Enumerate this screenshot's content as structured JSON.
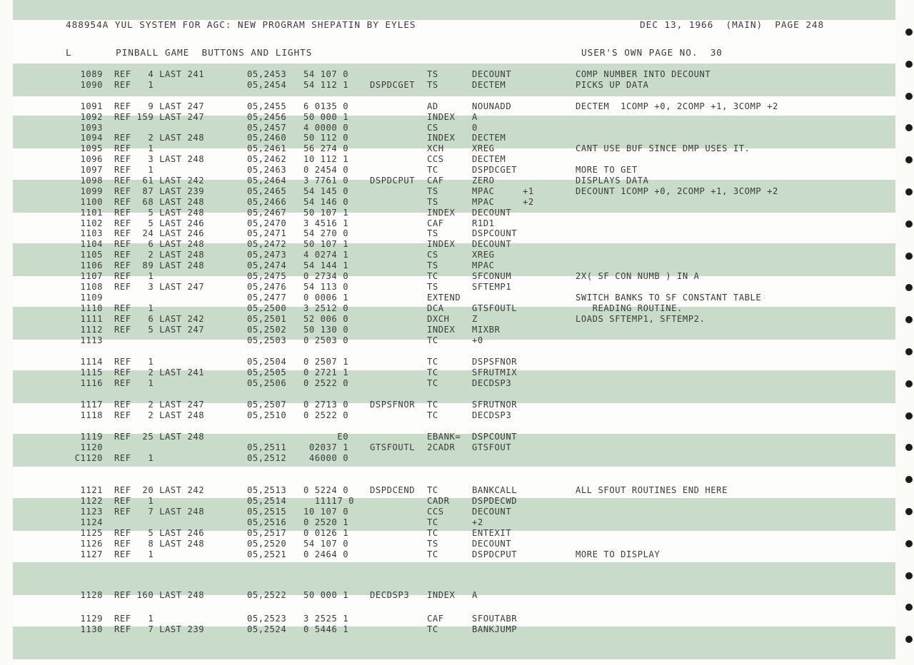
{
  "header": {
    "left": "488954A YUL SYSTEM FOR AGC: NEW PROGRAM SHEPATIN BY EYLES",
    "right": "DEC 13, 1966  (MAIN)  PAGE 248"
  },
  "section": {
    "marker": "L",
    "title": "PINBALL GAME  BUTTONS AND LIGHTS",
    "page_note": "USER'S OWN PAGE NO.  30"
  },
  "rows": [
    {
      "ln": "1089",
      "rf": "REF   4 LAST 241",
      "ad": "05,2453",
      "oc": "54 107 0",
      "lb": "",
      "op": "TS",
      "od": "DECOUNT",
      "cm": "COMP NUMBER INTO DECOUNT"
    },
    {
      "ln": "1090",
      "rf": "REF   1",
      "ad": "05,2454",
      "oc": "54 112 1",
      "lb": "DSPDCGET",
      "op": "TS",
      "od": "DECTEM",
      "cm": "PICKS UP DATA"
    },
    {
      "ln": "1091",
      "rf": "REF   9 LAST 247",
      "ad": "05,2455",
      "oc": "6 0135 0",
      "lb": "",
      "op": "AD",
      "od": "NOUNADD",
      "cm": "DECTEM  1COMP +0, 2COMP +1, 3COMP +2"
    },
    {
      "ln": "1092",
      "rf": "REF 159 LAST 247",
      "ad": "05,2456",
      "oc": "50 000 1",
      "lb": "",
      "op": "INDEX",
      "od": "A",
      "cm": ""
    },
    {
      "ln": "1093",
      "rf": "",
      "ad": "05,2457",
      "oc": "4 0000 0",
      "lb": "",
      "op": "CS",
      "od": "0",
      "cm": ""
    },
    {
      "ln": "1094",
      "rf": "REF   2 LAST 248",
      "ad": "05,2460",
      "oc": "50 112 0",
      "lb": "",
      "op": "INDEX",
      "od": "DECTEM",
      "cm": ""
    },
    {
      "ln": "1095",
      "rf": "REF   1",
      "ad": "05,2461",
      "oc": "56 274 0",
      "lb": "",
      "op": "XCH",
      "od": "XREG",
      "cm": "CANT USE BUF SINCE DMP USES IT."
    },
    {
      "ln": "1096",
      "rf": "REF   3 LAST 248",
      "ad": "05,2462",
      "oc": "10 112 1",
      "lb": "",
      "op": "CCS",
      "od": "DECTEM",
      "cm": ""
    },
    {
      "ln": "1097",
      "rf": "REF   1",
      "ad": "05,2463",
      "oc": "0 2454 0",
      "lb": "",
      "op": "TC",
      "od": "DSPDCGET",
      "cm": "MORE TO GET"
    },
    {
      "ln": "1098",
      "rf": "REF  61 LAST 242",
      "ad": "05,2464",
      "oc": "3 7761 0",
      "lb": "DSPDCPUT",
      "op": "CAF",
      "od": "ZERO",
      "cm": "DISPLAYS DATA"
    },
    {
      "ln": "1099",
      "rf": "REF  87 LAST 239",
      "ad": "05,2465",
      "oc": "54 145 0",
      "lb": "",
      "op": "TS",
      "od": "MPAC     +1",
      "cm": "DECOUNT 1COMP +0, 2COMP +1, 3COMP +2"
    },
    {
      "ln": "1100",
      "rf": "REF  68 LAST 248",
      "ad": "05,2466",
      "oc": "54 146 0",
      "lb": "",
      "op": "TS",
      "od": "MPAC     +2",
      "cm": ""
    },
    {
      "ln": "1101",
      "rf": "REF   5 LAST 248",
      "ad": "05,2467",
      "oc": "50 107 1",
      "lb": "",
      "op": "INDEX",
      "od": "DECOUNT",
      "cm": ""
    },
    {
      "ln": "1102",
      "rf": "REF   5 LAST 246",
      "ad": "05,2470",
      "oc": "3 4516 1",
      "lb": "",
      "op": "CAF",
      "od": "R1D1",
      "cm": ""
    },
    {
      "ln": "1103",
      "rf": "REF  24 LAST 246",
      "ad": "05,2471",
      "oc": "54 270 0",
      "lb": "",
      "op": "TS",
      "od": "DSPCOUNT",
      "cm": ""
    },
    {
      "ln": "1104",
      "rf": "REF   6 LAST 248",
      "ad": "05,2472",
      "oc": "50 107 1",
      "lb": "",
      "op": "INDEX",
      "od": "DECOUNT",
      "cm": ""
    },
    {
      "ln": "1105",
      "rf": "REF   2 LAST 248",
      "ad": "05,2473",
      "oc": "4 0274 1",
      "lb": "",
      "op": "CS",
      "od": "XREG",
      "cm": ""
    },
    {
      "ln": "1106",
      "rf": "REF  89 LAST 248",
      "ad": "05,2474",
      "oc": "54 144 1",
      "lb": "",
      "op": "TS",
      "od": "MPAC",
      "cm": ""
    },
    {
      "ln": "1107",
      "rf": "REF   1",
      "ad": "05,2475",
      "oc": "0 2734 0",
      "lb": "",
      "op": "TC",
      "od": "SFCONUM",
      "cm": "2X( SF CON NUMB ) IN A"
    },
    {
      "ln": "1108",
      "rf": "REF   3 LAST 247",
      "ad": "05,2476",
      "oc": "54 113 0",
      "lb": "",
      "op": "TS",
      "od": "SFTEMP1",
      "cm": ""
    },
    {
      "ln": "1109",
      "rf": "",
      "ad": "05,2477",
      "oc": "0 0006 1",
      "lb": "",
      "op": "EXTEND",
      "od": "",
      "cm": "SWITCH BANKS TO SF CONSTANT TABLE"
    },
    {
      "ln": "1110",
      "rf": "REF   1",
      "ad": "05,2500",
      "oc": "3 2512 0",
      "lb": "",
      "op": "DCA",
      "od": "GTSFOUTL",
      "cm": "   READING ROUTINE."
    },
    {
      "ln": "1111",
      "rf": "REF   6 LAST 242",
      "ad": "05,2501",
      "oc": "52 006 0",
      "lb": "",
      "op": "DXCH",
      "od": "Z",
      "cm": "LOADS SFTEMP1, SFTEMP2."
    },
    {
      "ln": "1112",
      "rf": "REF   5 LAST 247",
      "ad": "05,2502",
      "oc": "50 130 0",
      "lb": "",
      "op": "INDEX",
      "od": "MIXBR",
      "cm": ""
    },
    {
      "ln": "1113",
      "rf": "",
      "ad": "05,2503",
      "oc": "0 2503 0",
      "lb": "",
      "op": "TC",
      "od": "+0",
      "cm": ""
    },
    {
      "ln": "1114",
      "rf": "REF   1",
      "ad": "05,2504",
      "oc": "0 2507 1",
      "lb": "",
      "op": "TC",
      "od": "DSPSFNOR",
      "cm": ""
    },
    {
      "ln": "1115",
      "rf": "REF   2 LAST 241",
      "ad": "05,2505",
      "oc": "0 2721 1",
      "lb": "",
      "op": "TC",
      "od": "SFRUTMIX",
      "cm": ""
    },
    {
      "ln": "1116",
      "rf": "REF   1",
      "ad": "05,2506",
      "oc": "0 2522 0",
      "lb": "",
      "op": "TC",
      "od": "DECDSP3",
      "cm": ""
    },
    {
      "ln": "1117",
      "rf": "REF   2 LAST 247",
      "ad": "05,2507",
      "oc": "0 2713 0",
      "lb": "DSPSFNOR",
      "op": "TC",
      "od": "SFRUTNOR",
      "cm": ""
    },
    {
      "ln": "1118",
      "rf": "REF   2 LAST 248",
      "ad": "05,2510",
      "oc": "0 2522 0",
      "lb": "",
      "op": "TC",
      "od": "DECDSP3",
      "cm": ""
    },
    {
      "ln": "1119",
      "rf": "REF  25 LAST 248",
      "ad": "",
      "oc": "      E0",
      "lb": "",
      "op": "EBANK=",
      "od": "DSPCOUNT",
      "cm": ""
    },
    {
      "ln": "1120",
      "rf": "",
      "ad": "05,2511",
      "oc": " 02037 1",
      "lb": "GTSFOUTL",
      "op": "2CADR",
      "od": "GTSFOUT",
      "cm": ""
    },
    {
      "ln": "C1120",
      "rf": "REF   1",
      "ad": "05,2512",
      "oc": " 46000 0",
      "lb": "",
      "op": "",
      "od": "",
      "cm": ""
    },
    {
      "ln": "1121",
      "rf": "REF  20 LAST 242",
      "ad": "05,2513",
      "oc": "0 5224 0",
      "lb": "DSPDCEND",
      "op": "TC",
      "od": "BANKCALL",
      "cm": "ALL SFOUT ROUTINES END HERE"
    },
    {
      "ln": "1122",
      "rf": "REF   1",
      "ad": "05,2514",
      "oc": "  11117 0",
      "lb": "",
      "op": "CADR",
      "od": "DSPDECWD",
      "cm": ""
    },
    {
      "ln": "1123",
      "rf": "REF   7 LAST 248",
      "ad": "05,2515",
      "oc": "10 107 0",
      "lb": "",
      "op": "CCS",
      "od": "DECOUNT",
      "cm": ""
    },
    {
      "ln": "1124",
      "rf": "",
      "ad": "05,2516",
      "oc": "0 2520 1",
      "lb": "",
      "op": "TC",
      "od": "+2",
      "cm": ""
    },
    {
      "ln": "1125",
      "rf": "REF   5 LAST 246",
      "ad": "05,2517",
      "oc": "0 0126 1",
      "lb": "",
      "op": "TC",
      "od": "ENTEXIT",
      "cm": ""
    },
    {
      "ln": "1126",
      "rf": "REF   8 LAST 248",
      "ad": "05,2520",
      "oc": "54 107 0",
      "lb": "",
      "op": "TS",
      "od": "DECOUNT",
      "cm": ""
    },
    {
      "ln": "1127",
      "rf": "REF   1",
      "ad": "05,2521",
      "oc": "0 2464 0",
      "lb": "",
      "op": "TC",
      "od": "DSPDCPUT",
      "cm": "MORE TO DISPLAY"
    },
    {
      "ln": "1128",
      "rf": "REF 160 LAST 248",
      "ad": "05,2522",
      "oc": "50 000 1",
      "lb": "DECDSP3",
      "op": "INDEX",
      "od": "A",
      "cm": ""
    },
    {
      "ln": "1129",
      "rf": "REF   1",
      "ad": "05,2523",
      "oc": "3 2525 1",
      "lb": "",
      "op": "CAF",
      "od": "SFOUTABR",
      "cm": ""
    },
    {
      "ln": "1130",
      "rf": "REF   7 LAST 239",
      "ad": "05,2524",
      "oc": "0 5446 1",
      "lb": "",
      "op": "TC",
      "od": "BANKJUMP",
      "cm": ""
    }
  ]
}
